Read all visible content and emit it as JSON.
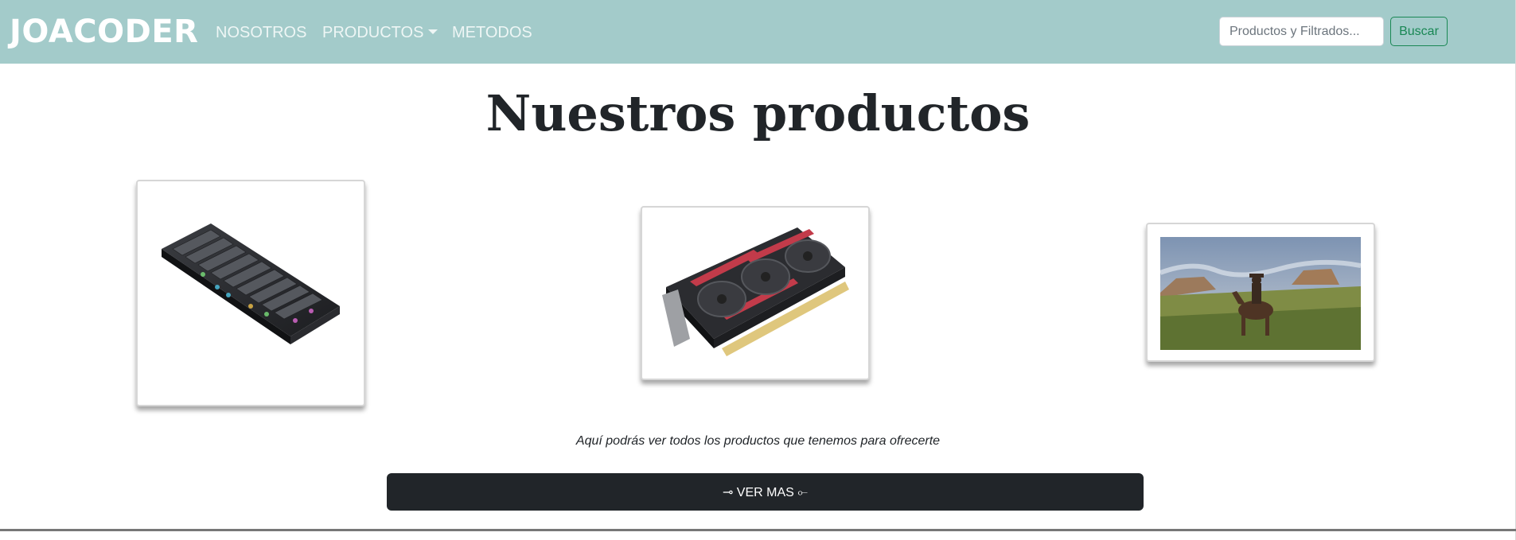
{
  "navbar": {
    "brand": "JOACODER",
    "links": [
      "NOSOTROS",
      "PRODUCTOS",
      "METODOS"
    ],
    "search": {
      "placeholder": "Productos y Filtrados...",
      "value": "",
      "button_label": "Buscar"
    },
    "colors": {
      "background": "#a3cbca",
      "search_button": "#198754"
    }
  },
  "main": {
    "title": "Nuestros productos",
    "products": [
      {
        "image": "mechanical-keyboard-rgb"
      },
      {
        "image": "graphics-card"
      },
      {
        "image": "cowboy-on-horse-landscape"
      }
    ],
    "subtitle": "Aquí podrás ver todos los productos que tenemos para ofrecerte",
    "cta_label": "⊸ VER MAS ⟜"
  }
}
